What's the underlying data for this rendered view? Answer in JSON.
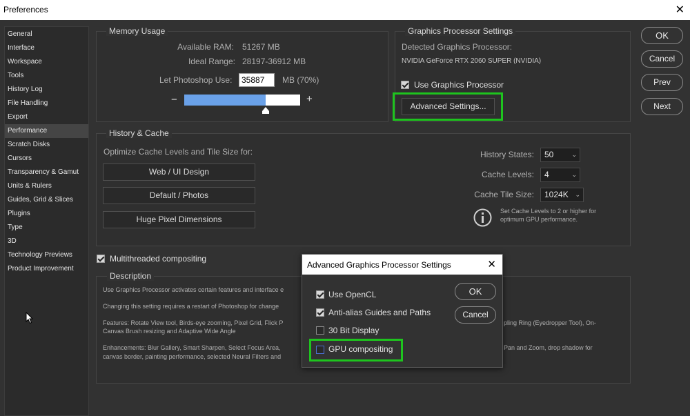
{
  "window": {
    "title": "Preferences",
    "close_glyph": "✕"
  },
  "sidebar": {
    "items": [
      {
        "label": "General"
      },
      {
        "label": "Interface"
      },
      {
        "label": "Workspace"
      },
      {
        "label": "Tools"
      },
      {
        "label": "History Log"
      },
      {
        "label": "File Handling"
      },
      {
        "label": "Export"
      },
      {
        "label": "Performance",
        "active": true
      },
      {
        "label": "Scratch Disks"
      },
      {
        "label": "Cursors"
      },
      {
        "label": "Transparency & Gamut"
      },
      {
        "label": "Units & Rulers"
      },
      {
        "label": "Guides, Grid & Slices"
      },
      {
        "label": "Plugins"
      },
      {
        "label": "Type"
      },
      {
        "label": "3D"
      },
      {
        "label": "Technology Previews"
      },
      {
        "label": "Product Improvement"
      }
    ]
  },
  "memory": {
    "legend": "Memory Usage",
    "available_label": "Available RAM:",
    "available_value": "51267 MB",
    "ideal_label": "Ideal Range:",
    "ideal_value": "28197-36912 MB",
    "let_use_label": "Let Photoshop Use:",
    "let_use_value": "35887",
    "let_use_unit": "MB (70%)",
    "minus": "−",
    "plus": "+",
    "slider_level": 0.7
  },
  "gpu": {
    "legend": "Graphics Processor Settings",
    "detected_label": "Detected Graphics Processor:",
    "detected_value": "NVIDIA GeForce RTX 2060 SUPER (NVIDIA)",
    "use_label": "Use Graphics Processor",
    "use_checked": true,
    "advanced_button": "Advanced Settings..."
  },
  "actions": {
    "ok": "OK",
    "cancel": "Cancel",
    "prev": "Prev",
    "next": "Next"
  },
  "history_cache": {
    "legend": "History & Cache",
    "optimize_label": "Optimize Cache Levels and Tile Size for:",
    "buttons": [
      "Web / UI Design",
      "Default / Photos",
      "Huge Pixel Dimensions"
    ],
    "history_states_label": "History States:",
    "history_states_value": "50",
    "cache_levels_label": "Cache Levels:",
    "cache_levels_value": "4",
    "tile_size_label": "Cache Tile Size:",
    "tile_size_value": "1024K",
    "info_line1": "Set Cache Levels to 2 or higher for",
    "info_line2": "optimum GPU performance."
  },
  "multithreaded": {
    "label": "Multithreaded compositing",
    "checked": true
  },
  "description": {
    "legend": "Description",
    "line1": "Use Graphics Processor activates certain features and interface e",
    "line2": "Changing this setting requires a restart of Photoshop for change",
    "line3a": "Features: Rotate View tool, Birds-eye zooming, Pixel Grid, Flick P",
    "line3b": "Canvas Brush resizing and Adaptive Wide Angle",
    "line3c": "pling Ring (Eyedropper Tool), On-",
    "line4a": "Enhancements: Blur Gallery, Smart Sharpen, Select Focus Area,",
    "line4b": "canvas border, painting performance, selected Neural Filters and",
    "line4c": "Pan and Zoom, drop shadow for"
  },
  "dialog": {
    "title": "Advanced Graphics Processor Settings",
    "close_glyph": "✕",
    "options": [
      {
        "label": "Use OpenCL",
        "checked": true
      },
      {
        "label": "Anti-alias Guides and Paths",
        "checked": true
      },
      {
        "label": "30 Bit Display",
        "checked": false
      },
      {
        "label": "GPU compositing",
        "checked": false
      }
    ],
    "ok": "OK",
    "cancel": "Cancel"
  },
  "colors": {
    "highlight": "#1ec41e",
    "slider_fill": "#6aa1e8"
  }
}
